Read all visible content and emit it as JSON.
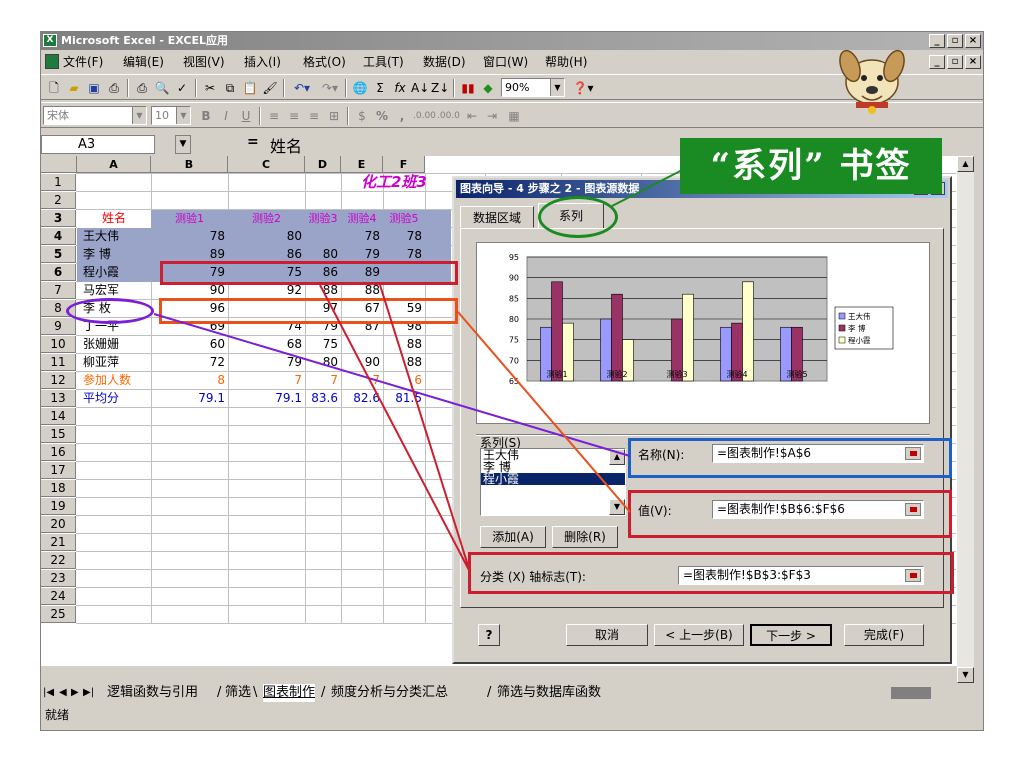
{
  "app": {
    "title": "Microsoft Excel - EXCEL应用",
    "menu": [
      "文件(F)",
      "编辑(E)",
      "视图(V)",
      "插入(I)",
      "格式(O)",
      "工具(T)",
      "数据(D)",
      "窗口(W)",
      "帮助(H)"
    ],
    "zoom": "90%",
    "font_name": "宋体",
    "font_size": "10",
    "name_box": "A3",
    "formula": "姓名"
  },
  "sheet": {
    "columns": [
      "A",
      "B",
      "C",
      "D",
      "E",
      "F"
    ],
    "rows": [
      "1",
      "2",
      "3",
      "4",
      "5",
      "6",
      "7",
      "8",
      "9",
      "10",
      "11",
      "12",
      "13",
      "14",
      "15",
      "16",
      "17",
      "18",
      "19",
      "20",
      "21",
      "22",
      "23",
      "24",
      "25"
    ],
    "title_text": "化工2班3",
    "header": [
      "姓名",
      "测验1",
      "测验2",
      "测验3",
      "测验4",
      "测验5"
    ],
    "data": [
      [
        "王大伟",
        "78",
        "80",
        "",
        "78",
        "78"
      ],
      [
        "李  博",
        "89",
        "86",
        "80",
        "79",
        "78"
      ],
      [
        "程小霞",
        "79",
        "75",
        "86",
        "89",
        ""
      ],
      [
        "马宏军",
        "90",
        "92",
        "88",
        "88",
        ""
      ],
      [
        "李  枚",
        "96",
        "",
        "97",
        "67",
        "59"
      ],
      [
        "丁一平",
        "69",
        "74",
        "79",
        "87",
        "98"
      ],
      [
        "张姗姗",
        "60",
        "68",
        "75",
        "",
        "88"
      ],
      [
        "柳亚萍",
        "72",
        "79",
        "80",
        "90",
        "88"
      ],
      [
        "参加人数",
        "8",
        "7",
        "7",
        "7",
        "6"
      ],
      [
        "平均分",
        "79.1",
        "79.1",
        "83.6",
        "82.6",
        "81.5"
      ]
    ],
    "extra_col_g_row13": "7",
    "tabs": [
      "逻辑函数与引用",
      "筛选",
      "图表制作",
      "频度分析与分类汇总",
      "筛选与数据库函数"
    ],
    "active_tab": "图表制作",
    "status": "就绪"
  },
  "dialog": {
    "title": "图表向导 - 4 步骤之 2 - 图表源数据",
    "tabs": [
      "数据区域",
      "系列"
    ],
    "series_label": "系列(S)",
    "series_items": [
      "王大伟",
      "李  博",
      "程小霞"
    ],
    "name_label": "名称(N):",
    "name_value": "=图表制作!$A$6",
    "value_label": "值(V):",
    "value_value": "=图表制作!$B$6:$F$6",
    "category_label": "分类 (X) 轴标志(T):",
    "category_value": "=图表制作!$B$3:$F$3",
    "add_button": "添加(A)",
    "delete_button": "删除(R)",
    "cancel_button": "取消",
    "back_button": "< 上一步(B)",
    "next_button": "下一步 >",
    "finish_button": "完成(F)"
  },
  "callout": {
    "text": "“系列” 书签"
  },
  "chart_data": {
    "type": "bar",
    "categories": [
      "测验1",
      "测验2",
      "测验3",
      "测验4",
      "测验5"
    ],
    "series": [
      {
        "name": "王大伟",
        "values": [
          78,
          80,
          null,
          78,
          78
        ],
        "color": "#9999ff"
      },
      {
        "name": "李 博",
        "values": [
          89,
          86,
          80,
          79,
          78
        ],
        "color": "#993366"
      },
      {
        "name": "程小霞",
        "values": [
          79,
          75,
          86,
          89,
          null
        ],
        "color": "#ffffcc"
      }
    ],
    "ylim": [
      65,
      95
    ],
    "yticks": [
      65,
      70,
      75,
      80,
      85,
      90,
      95
    ],
    "legend": "right",
    "grid": true
  },
  "colors": {
    "selection": "#9aa3c8",
    "header_text": "#cc00cc",
    "orange_text": "#ff6600",
    "blue_text": "#0000cc",
    "red_text": "#ff0000",
    "annotation_red": "#cc1e2e",
    "annotation_blue": "#1f5fc8",
    "annotation_green": "#1a8a22",
    "annotation_purple": "#7a1fd6",
    "annotation_orange": "#e8501c"
  }
}
